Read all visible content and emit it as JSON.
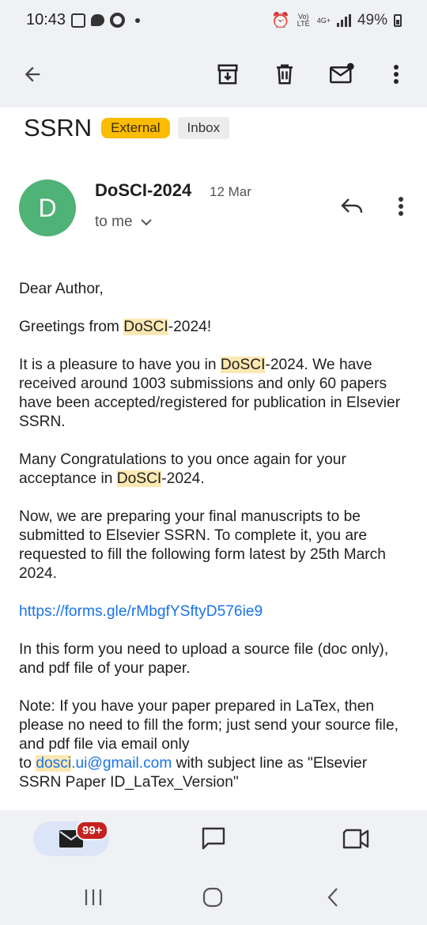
{
  "status_bar": {
    "time": "10:43",
    "battery": "49%",
    "network": "4G+",
    "volte": "Vo) LTE"
  },
  "toolbar": {
    "icons": [
      "back-arrow-icon",
      "archive-icon",
      "delete-icon",
      "mark-unread-icon",
      "more-vert-icon"
    ]
  },
  "email": {
    "subject": "SSRN",
    "labels": [
      "External",
      "Inbox"
    ],
    "avatar_letter": "D",
    "sender": "DoSCI-2024",
    "date": "12 Mar",
    "to": "to me",
    "body": {
      "greeting": "Dear Author,",
      "greetings_prefix": "Greetings from ",
      "greetings_hl": "DoSCI",
      "greetings_suffix": "-2024!",
      "p1_prefix": "It is a pleasure to have you in ",
      "p1_hl": "DoSCI",
      "p1_suffix": "-2024. We have received around 1003 submissions and only 60 papers have been accepted/registered for publication in Elsevier SSRN.",
      "p2_prefix": "Many Congratulations to you once again for your acceptance in ",
      "p2_hl": "DoSCI",
      "p2_suffix": "-2024.",
      "p3": "Now, we are preparing your final manuscripts to be submitted to Elsevier SSRN. To complete it, you are requested to fill the following form latest by 25th March 2024.",
      "link": "https://forms.gle/rMbgfYSftyD576ie9",
      "p4": "In this form you need to upload a source file (doc only), and pdf file of your paper.",
      "note": "Note: If you have your paper prepared in LaTex, then please no need to fill the form; just send your source file, and pdf file via email only",
      "note_to": "to ",
      "email_hl": "dosci",
      "email_rest": ".ui@gmail.com",
      "note_suffix": " with subject line as \"Elsevier SSRN Paper ID_LaTex_Version\""
    }
  },
  "bottom_nav": {
    "mail_badge": "99+",
    "accent": "#1a73e8"
  }
}
